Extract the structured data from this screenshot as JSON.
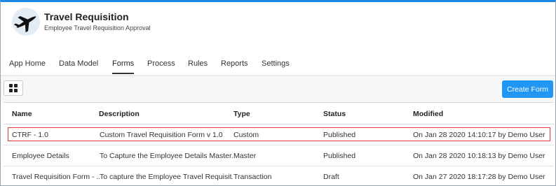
{
  "app": {
    "title": "Travel Requisition",
    "subtitle": "Employee Travel Requisition Approval",
    "logo_icon": "airplane-icon"
  },
  "tabs": [
    {
      "label": "App Home"
    },
    {
      "label": "Data Model"
    },
    {
      "label": "Forms",
      "active": true
    },
    {
      "label": "Process"
    },
    {
      "label": "Rules"
    },
    {
      "label": "Reports"
    },
    {
      "label": "Settings"
    }
  ],
  "toolbar": {
    "view_icon": "grid-view-icon",
    "create_label": "Create Form"
  },
  "table": {
    "headers": {
      "name": "Name",
      "description": "Description",
      "type": "Type",
      "status": "Status",
      "modified": "Modified"
    },
    "rows": [
      {
        "name": "CTRF - 1.0",
        "description": "Custom Travel Requisition Form v 1.0",
        "type": "Custom",
        "status": "Published",
        "modified": "On Jan 28 2020 14:10:17 by Demo User"
      },
      {
        "name": "Employee Details",
        "description": "To Capture the Employee Details Master...",
        "type": "Master",
        "status": "Published",
        "modified": "On Jan 28 2020 10:18:13 by Demo User"
      },
      {
        "name": "Travel Requisition Form - ...",
        "description": "To capture the Employee Travel Requisit...",
        "type": "Transaction",
        "status": "Draft",
        "modified": "On Jan 27 2020 18:17:28 by Demo User"
      }
    ]
  },
  "colors": {
    "accent": "#2196f3",
    "highlight": "#e53935"
  }
}
